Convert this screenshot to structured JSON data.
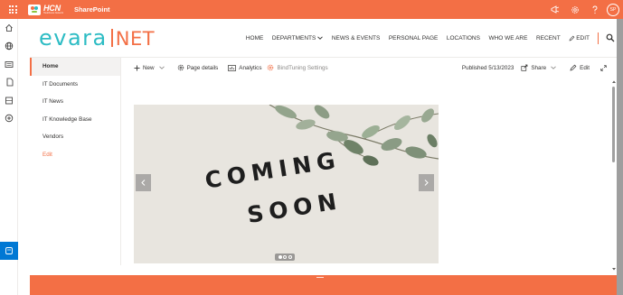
{
  "suite_bar": {
    "brand_text": "HCN",
    "brand_sub": "Healthcare Network",
    "app_name": "SharePoint",
    "avatar_initials": "SP",
    "icons": [
      "waffle-icon",
      "megaphone-icon",
      "gear-icon",
      "help-icon"
    ]
  },
  "site_header": {
    "logo_evara": "evara",
    "logo_net": "NET",
    "nav": [
      {
        "label": "HOME"
      },
      {
        "label": "DEPARTMENTS"
      },
      {
        "label": "NEWS & EVENTS"
      },
      {
        "label": "PERSONAL PAGE"
      },
      {
        "label": "LOCATIONS"
      },
      {
        "label": "WHO WE ARE"
      },
      {
        "label": "RECENT"
      },
      {
        "label": "EDIT"
      }
    ]
  },
  "left_nav": {
    "items": [
      {
        "label": "Home",
        "selected": true
      },
      {
        "label": "IT Documents"
      },
      {
        "label": "IT News"
      },
      {
        "label": "IT Knowledge Base"
      },
      {
        "label": "Vendors"
      },
      {
        "label": "Edit",
        "accent": true
      }
    ]
  },
  "command_bar": {
    "new_label": "New",
    "page_details_label": "Page details",
    "analytics_label": "Analytics",
    "bindtuning_label": "BindTuning Settings",
    "published_label": "Published 5/13/2023",
    "share_label": "Share",
    "edit_label": "Edit"
  },
  "carousel": {
    "line1": "COMING",
    "line2": "SOON",
    "slide_count": 3,
    "active_slide": 1
  },
  "colors": {
    "accent": "#f36f45",
    "teal": "#2dbcc4",
    "text": "#323130"
  }
}
